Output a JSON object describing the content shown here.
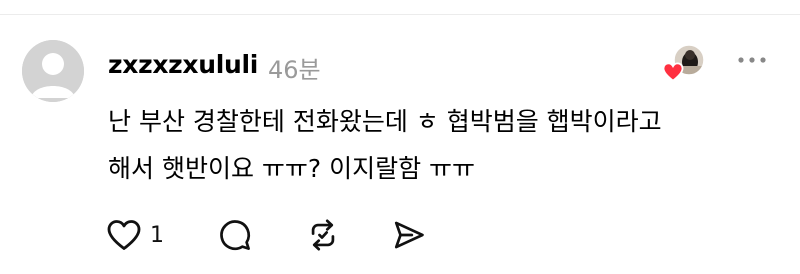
{
  "comment": {
    "username": "zxzxzxululi",
    "time_ago": "46분",
    "body_lines": [
      "난 부산 경찰한테 전화왔는데 ㅎ 협박범을 햅박이라고",
      "해서 햇반이요 ㅠㅠ? 이지랄함 ㅠㅠ"
    ],
    "like_count": "1"
  },
  "icons": {
    "avatar": "default-avatar",
    "liked_by": "liker-avatar-with-heart",
    "more": "more-dots-icon",
    "like": "heart-outline-icon",
    "reply": "speech-bubble-icon",
    "repost": "repost-arrows-icon",
    "share": "send-icon"
  },
  "colors": {
    "heart_badge": "#ff3040",
    "timestamp": "#9a9a9a",
    "avatar_bg": "#d3d3d3"
  }
}
